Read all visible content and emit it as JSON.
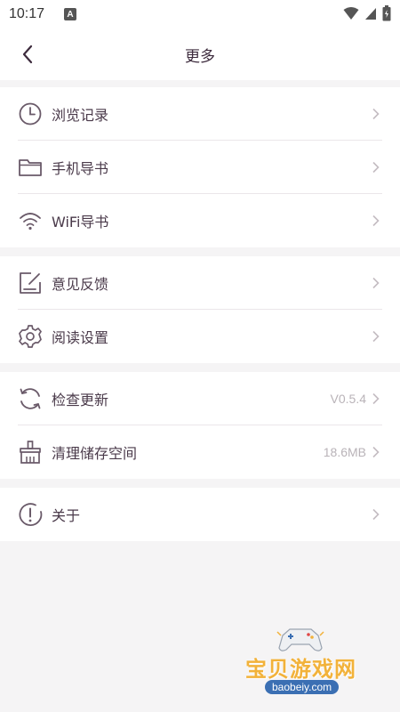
{
  "status_bar": {
    "time": "10:17",
    "notif_letter": "A"
  },
  "header": {
    "title": "更多"
  },
  "groups": [
    {
      "items": [
        {
          "label": "浏览记录",
          "icon": "clock-icon"
        },
        {
          "label": "手机导书",
          "icon": "folder-icon"
        },
        {
          "label": "WiFi导书",
          "icon": "wifi-icon"
        }
      ]
    },
    {
      "items": [
        {
          "label": "意见反馈",
          "icon": "feedback-edit-icon"
        },
        {
          "label": "阅读设置",
          "icon": "gear-icon"
        }
      ]
    },
    {
      "items": [
        {
          "label": "检查更新",
          "icon": "refresh-icon",
          "value": "V0.5.4"
        },
        {
          "label": "清理储存空间",
          "icon": "broom-icon",
          "value": "18.6MB"
        }
      ]
    },
    {
      "items": [
        {
          "label": "关于",
          "icon": "info-exclamation-icon"
        }
      ]
    }
  ],
  "watermark": {
    "brand": "宝贝游戏网",
    "url": "baobeiy.com"
  },
  "colors": {
    "icon": "#6a5a69",
    "text": "#4a3a4a",
    "muted": "#b9b3b8",
    "background": "#f5f4f5"
  }
}
